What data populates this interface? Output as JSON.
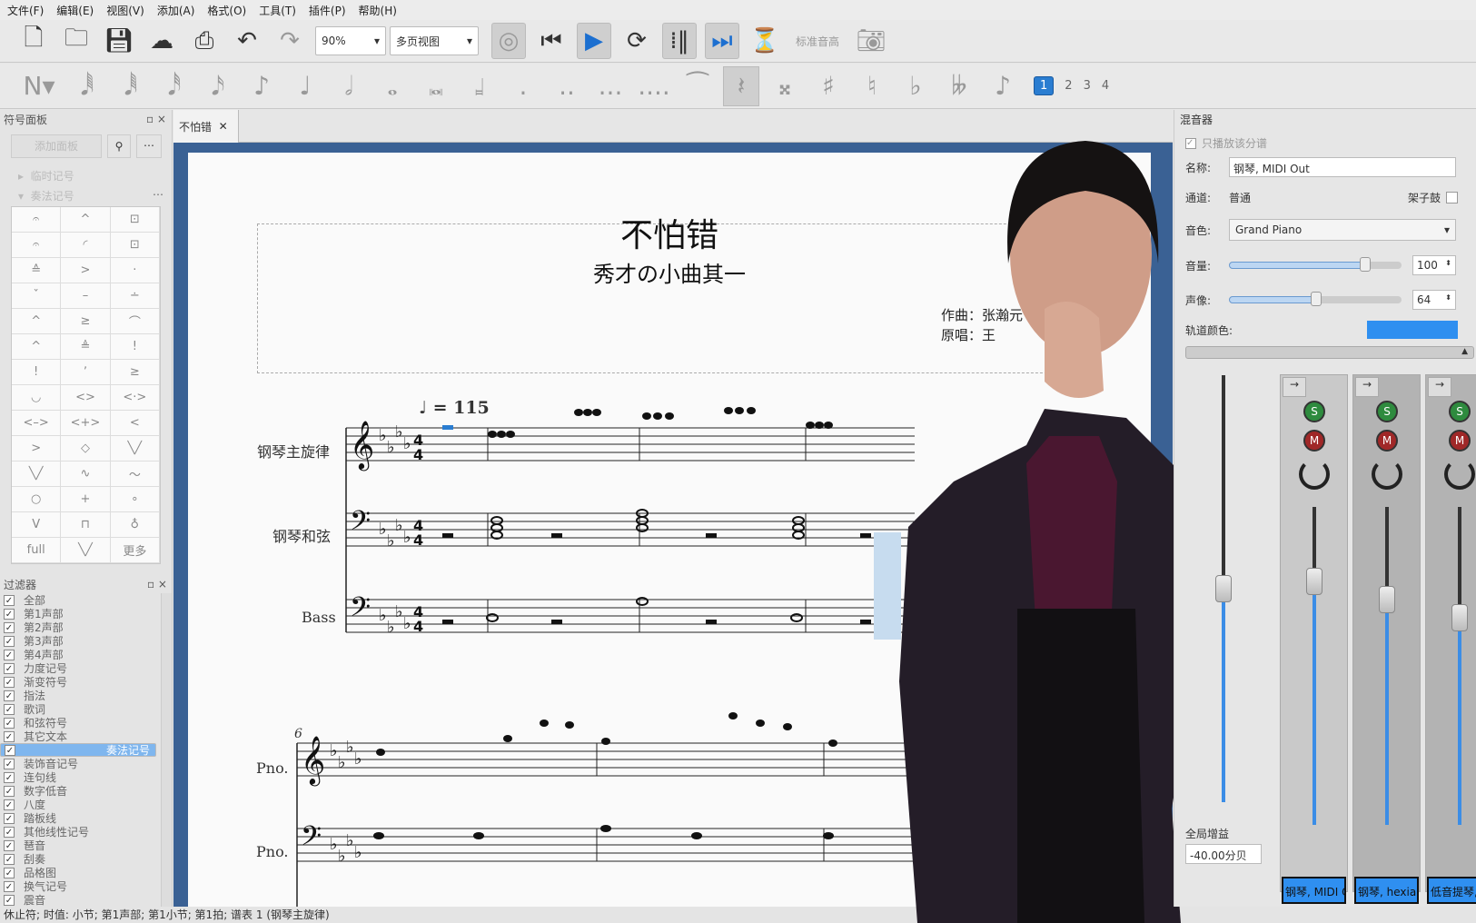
{
  "menu": [
    "文件(F)",
    "编辑(E)",
    "视图(V)",
    "添加(A)",
    "格式(O)",
    "工具(T)",
    "插件(P)",
    "帮助(H)"
  ],
  "toolbar": {
    "zoom": "90%",
    "view_mode": "多页视图",
    "concert_pitch": "标准音高"
  },
  "voices": [
    "1",
    "2",
    "3",
    "4"
  ],
  "palette": {
    "title": "符号面板",
    "add_button": "添加面板",
    "sections": [
      "临时记号",
      "奏法记号"
    ],
    "cells": [
      "𝄐",
      "^",
      "⊡",
      "𝄐",
      "◜",
      "⊡",
      "≙",
      ">",
      "·",
      "ˇ",
      "–",
      "∸",
      "^",
      "≥",
      "⌒",
      "^",
      "≜",
      "!",
      "!",
      "ʼ",
      "≥",
      "◡",
      "<>",
      "<·>",
      "<–>",
      "<+>",
      "<",
      ">",
      "◇",
      "╲╱",
      "╲╱",
      "∿",
      "〜",
      "○",
      "+",
      "∘",
      "V",
      "⊓",
      "♁",
      "full",
      "╲╱",
      "更多"
    ]
  },
  "filter": {
    "title": "过滤器",
    "items": [
      "全部",
      "第1声部",
      "第2声部",
      "第3声部",
      "第4声部",
      "力度记号",
      "渐变符号",
      "指法",
      "歌词",
      "和弦符号",
      "其它文本",
      "奏法记号",
      "装饰音记号",
      "连句线",
      "数字低音",
      "八度",
      "踏板线",
      "其他线性记号",
      "琶音",
      "刮奏",
      "品格图",
      "换气记号",
      "震音"
    ],
    "selected": "奏法记号"
  },
  "status": "休止符; 时值: 小节; 第1声部;  第1小节; 第1拍; 谱表 1 (钢琴主旋律)",
  "tab": {
    "label": "不怕错"
  },
  "score": {
    "title": "不怕错",
    "subtitle": "秀才の小曲其一",
    "composer": "作曲：张瀚元",
    "lyricist": "原唱：王",
    "tempo": "♩ = 115",
    "instruments": [
      "钢琴主旋律",
      "钢琴和弦",
      "Bass"
    ],
    "system2_measure": "6",
    "short_names": [
      "Pno.",
      "Pno."
    ]
  },
  "mixer": {
    "title": "混音器",
    "solo_part": "只播放该分谱",
    "name_label": "名称:",
    "name_value": "钢琴, MIDI Out",
    "channel_label": "通道:",
    "channel_value": "普通",
    "drumset_label": "架子鼓",
    "sound_label": "音色:",
    "sound_value": "Grand Piano",
    "volume_label": "音量:",
    "volume": 100,
    "pan_label": "声像:",
    "pan": 64,
    "track_color_label": "轨道颜色:",
    "track_color": "#2f8ff0",
    "master_gain_label": "全局增益",
    "master_gain": "-40.00分贝",
    "strips": [
      "钢琴, MIDI Out",
      "钢琴, hexian",
      "低音提琴,"
    ],
    "solo": "S",
    "mute": "M"
  }
}
